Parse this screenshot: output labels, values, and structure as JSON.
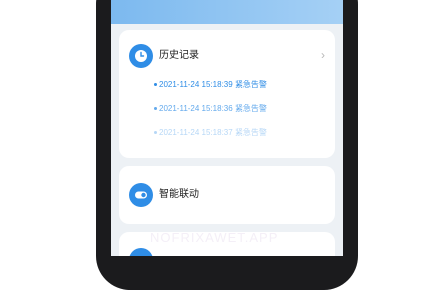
{
  "history": {
    "title": "历史记录",
    "chevron": "›",
    "items": [
      {
        "time": "2021-11-24 15:18:39",
        "label": "紧急告警"
      },
      {
        "time": "2021-11-24 15:18:36",
        "label": "紧急告警"
      },
      {
        "time": "2021-11-24 15:18:37",
        "label": "紧急告警"
      }
    ]
  },
  "linkage": {
    "title": "智能联动"
  },
  "watermark": "NOFRIXAWET.APP",
  "colors": {
    "accent": "#2f8de6",
    "background": "#edf1f5",
    "card": "#ffffff",
    "phone_frame": "#1b1b1d"
  },
  "icons": {
    "history": "clock-icon",
    "linkage": "toggle-icon",
    "third": "circle-icon"
  }
}
